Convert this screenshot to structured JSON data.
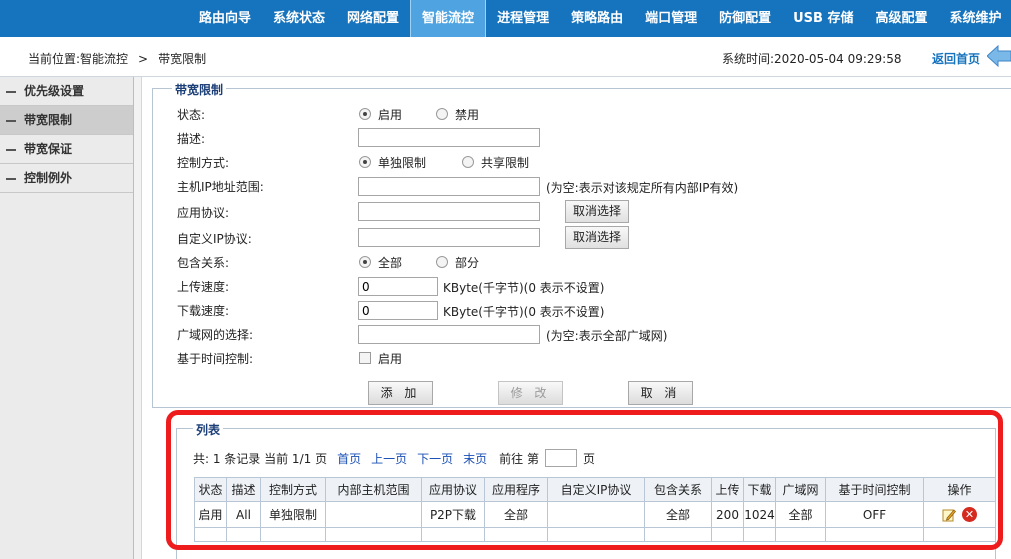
{
  "topnav": {
    "items": [
      {
        "label": "路由向导"
      },
      {
        "label": "系统状态"
      },
      {
        "label": "网络配置"
      },
      {
        "label": "智能流控",
        "active": true
      },
      {
        "label": "进程管理"
      },
      {
        "label": "策略路由"
      },
      {
        "label": "端口管理"
      },
      {
        "label": "防御配置"
      },
      {
        "label": "USB 存储"
      },
      {
        "label": "高级配置"
      },
      {
        "label": "系统维护"
      }
    ]
  },
  "breadcrumb": {
    "prefix": "当前位置:智能流控",
    "separator": ">",
    "current": "带宽限制"
  },
  "system_time": "系统时间:2020-05-04 09:29:58",
  "return_home": "返回首页",
  "sidebar": {
    "items": [
      {
        "label": "优先级设置"
      },
      {
        "label": "带宽限制",
        "active": true
      },
      {
        "label": "带宽保证"
      },
      {
        "label": "控制例外"
      }
    ]
  },
  "form": {
    "legend": "带宽限制",
    "status_label": "状态:",
    "status_on": "启用",
    "status_off": "禁用",
    "desc_label": "描述:",
    "desc_value": "",
    "control_label": "控制方式:",
    "control_single": "单独限制",
    "control_shared": "共享限制",
    "ip_label": "主机IP地址范围:",
    "ip_value": "",
    "ip_hint": "(为空:表示对该规定所有内部IP有效)",
    "app_label": "应用协议:",
    "app_value": "",
    "custom_label": "自定义IP协议:",
    "custom_value": "",
    "cancel_select": "取消选择",
    "include_label": "包含关系:",
    "include_all": "全部",
    "include_part": "部分",
    "upload_label": "上传速度:",
    "upload_value": "0",
    "download_label": "下载速度:",
    "download_value": "0",
    "speed_hint": "KByte(千字节)(0 表示不设置)",
    "wan_label": "广域网的选择:",
    "wan_value": "",
    "wan_hint": "(为空:表示全部广域网)",
    "time_label": "基于时间控制:",
    "time_enable": "启用",
    "add_button": "添 加",
    "modify_button": "修 改",
    "cancel_button": "取 消"
  },
  "list": {
    "legend": "列表",
    "summary": "共: 1 条记录 当前 1/1 页",
    "first": "首页",
    "prev": "上一页",
    "next": "下一页",
    "last": "末页",
    "goto_prefix": "前往 第",
    "goto_suffix": "页",
    "goto_value": "",
    "columns": [
      "状态",
      "描述",
      "控制方式",
      "内部主机范围",
      "应用协议",
      "应用程序",
      "自定义IP协议",
      "包含关系",
      "上传",
      "下载",
      "广域网",
      "基于时间控制",
      "操作"
    ],
    "rows": [
      [
        "启用",
        "All",
        "单独限制",
        "",
        "P2P下载",
        "全部",
        "",
        "全部",
        "200",
        "1024",
        "全部",
        "OFF",
        ""
      ]
    ]
  },
  "colors": {
    "nav_bg": "#1673bd",
    "nav_active": "#4fa3e0",
    "highlight": "#ee1c1c",
    "link": "#1a4fb5"
  }
}
